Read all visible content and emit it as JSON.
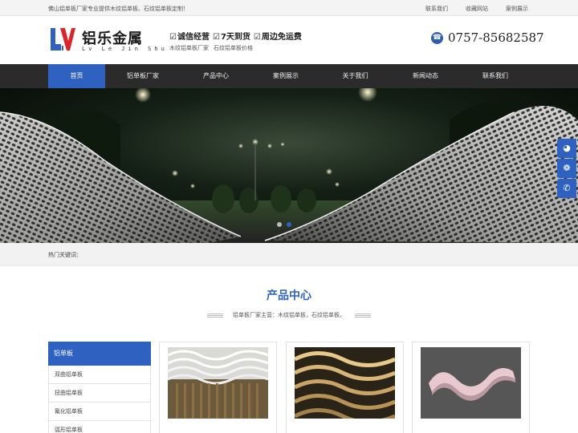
{
  "topbar": {
    "intro": "佛山铝单板厂家专业提供木纹铝单板、石纹铝单板定制！",
    "links": [
      "联系我们",
      "收藏网站",
      "案例展示"
    ]
  },
  "header": {
    "logo_cn": "铝乐金属",
    "logo_en": "Lv Le Jin Shu",
    "slogans": [
      "诚信经营",
      "7天到货",
      "周边免运费"
    ],
    "keywords": [
      "木纹铝单板厂家",
      "石纹铝单板价格"
    ],
    "phone": "0757-85682587"
  },
  "nav": {
    "items": [
      "首页",
      "铝单板厂家",
      "产品中心",
      "案例展示",
      "关于我们",
      "新闻动态",
      "联系我们"
    ],
    "active_index": 0
  },
  "float_bar": {
    "icons": [
      "qq-icon",
      "wechat-icon",
      "phone-icon"
    ]
  },
  "hot": {
    "label": "热门关键词："
  },
  "products": {
    "title": "产品中心",
    "subtitle": "铝单板厂家主营：木纹铝单板，石纹铝单板。",
    "sidebar_head": "铝单板",
    "categories": [
      "双曲铝单板",
      "扭曲铝单板",
      "氟化铝单板",
      "弧形铝单板"
    ]
  },
  "colors": {
    "brand_blue": "#2f62c0",
    "nav_bg": "#2b2b2b"
  }
}
